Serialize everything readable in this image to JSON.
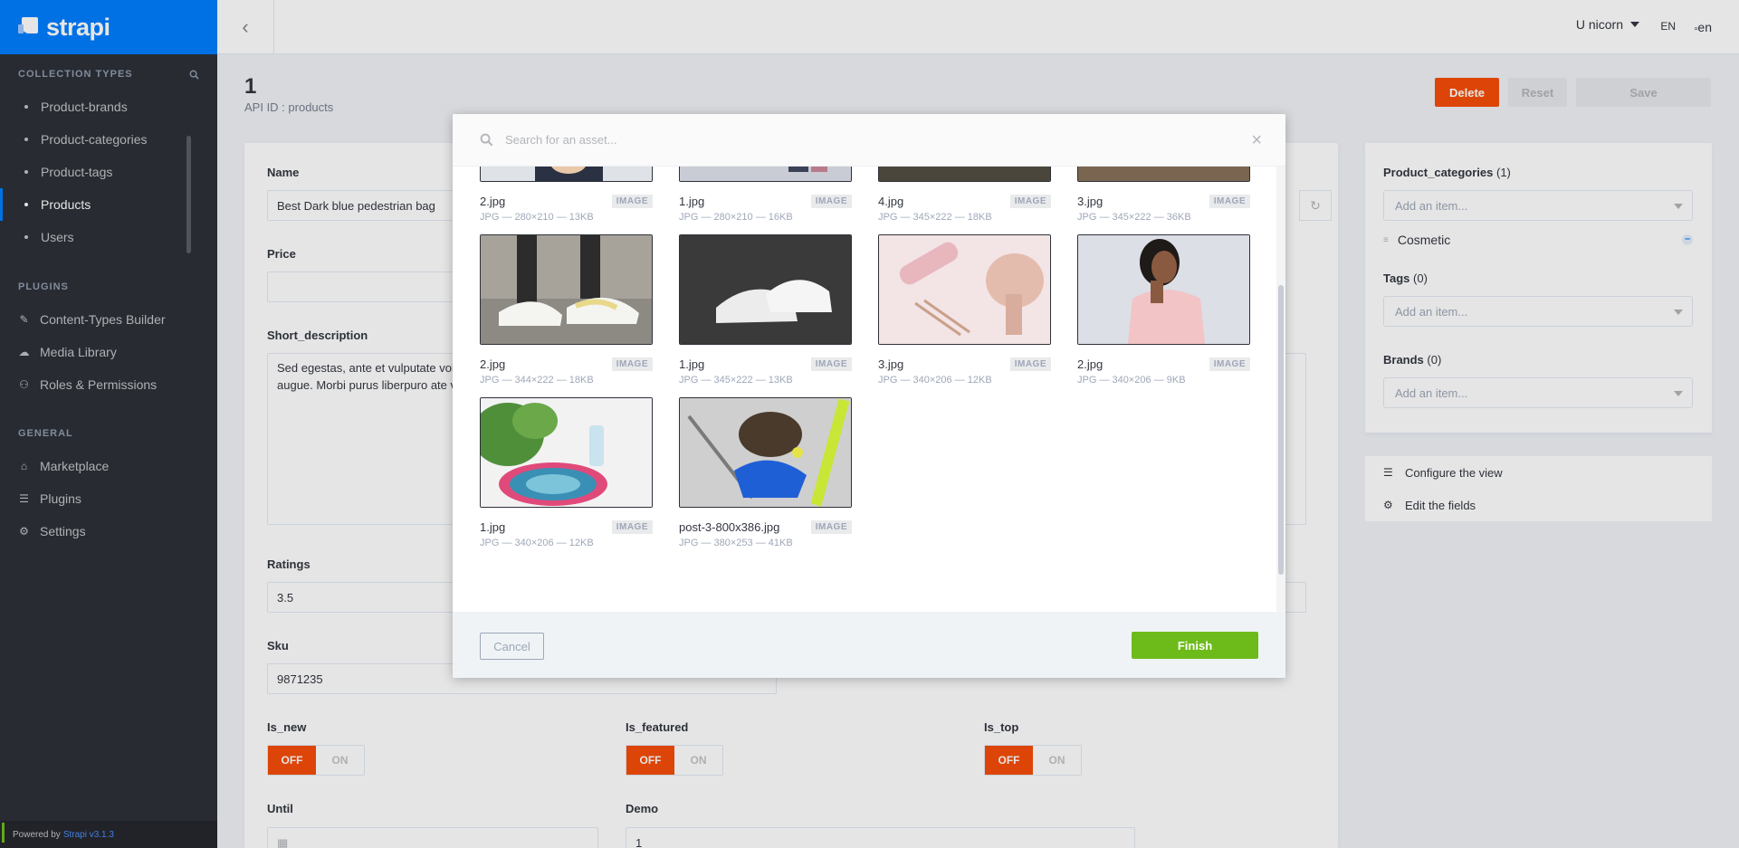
{
  "brand": {
    "name": "strapi"
  },
  "sidebar": {
    "collection_title": "COLLECTION TYPES",
    "collection_items": [
      {
        "label": "Product-brands",
        "active": false
      },
      {
        "label": "Product-categories",
        "active": false
      },
      {
        "label": "Product-tags",
        "active": false
      },
      {
        "label": "Products",
        "active": true
      },
      {
        "label": "Users",
        "active": false
      }
    ],
    "plugins_title": "PLUGINS",
    "plugins_items": [
      {
        "label": "Content-Types Builder",
        "icon": "paint-brush-icon"
      },
      {
        "label": "Media Library",
        "icon": "cloud-upload-icon"
      },
      {
        "label": "Roles & Permissions",
        "icon": "users-icon"
      }
    ],
    "general_title": "GENERAL",
    "general_items": [
      {
        "label": "Marketplace",
        "icon": "shopping-basket-icon"
      },
      {
        "label": "Plugins",
        "icon": "list-icon"
      },
      {
        "label": "Settings",
        "icon": "cog-icon"
      }
    ],
    "powered_by": "Powered by",
    "version": "Strapi v3.1.3"
  },
  "topbar": {
    "user": "U nicorn",
    "lang": "EN",
    "flag_alt": "en"
  },
  "header": {
    "title": "1",
    "api_id": "API ID : products",
    "delete_label": "Delete",
    "reset_label": "Reset",
    "save_label": "Save"
  },
  "form": {
    "name_label": "Name",
    "name_value": "Best Dark blue pedestrian bag",
    "price_label": "Price",
    "short_desc_label": "Short_description",
    "short_desc_line1": "Sed egestas, ante et vulputate volu",
    "short_desc_line2": "augue. Morbi purus liberpuro ate v",
    "ratings_label": "Ratings",
    "ratings_value": "3.5",
    "sku_label": "Sku",
    "sku_value": "9871235",
    "is_new_label": "Is_new",
    "is_featured_label": "Is_featured",
    "is_top_label": "Is_top",
    "off_label": "OFF",
    "on_label": "ON",
    "until_label": "Until",
    "demo_label": "Demo",
    "demo_value": "1"
  },
  "right_panel": {
    "categories_label": "Product_categories",
    "categories_count": "(1)",
    "add_item_placeholder": "Add an item...",
    "category_item": "Cosmetic",
    "tags_label": "Tags",
    "tags_count": "(0)",
    "brands_label": "Brands",
    "brands_count": "(0)",
    "configure_view": "Configure the view",
    "edit_fields": "Edit the fields"
  },
  "modal": {
    "search_placeholder": "Search for an asset...",
    "cancel_label": "Cancel",
    "finish_label": "Finish",
    "assets": [
      {
        "name": "2.jpg",
        "type": "IMAGE",
        "meta": "JPG — 280×210 — 13KB"
      },
      {
        "name": "1.jpg",
        "type": "IMAGE",
        "meta": "JPG — 280×210 — 16KB"
      },
      {
        "name": "4.jpg",
        "type": "IMAGE",
        "meta": "JPG — 345×222 — 18KB"
      },
      {
        "name": "3.jpg",
        "type": "IMAGE",
        "meta": "JPG — 345×222 — 36KB"
      },
      {
        "name": "2.jpg",
        "type": "IMAGE",
        "meta": "JPG — 344×222 — 18KB"
      },
      {
        "name": "1.jpg",
        "type": "IMAGE",
        "meta": "JPG — 345×222 — 13KB"
      },
      {
        "name": "3.jpg",
        "type": "IMAGE",
        "meta": "JPG — 340×206 — 12KB"
      },
      {
        "name": "2.jpg",
        "type": "IMAGE",
        "meta": "JPG — 340×206 — 9KB"
      },
      {
        "name": "1.jpg",
        "type": "IMAGE",
        "meta": "JPG — 340×206 — 12KB"
      },
      {
        "name": "post-3-800x386.jpg",
        "type": "IMAGE",
        "meta": "JPG — 380×253 — 41KB"
      }
    ]
  }
}
